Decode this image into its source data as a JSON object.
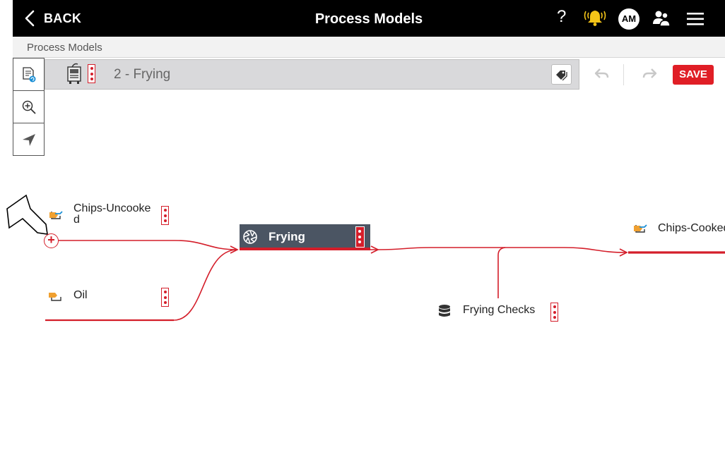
{
  "header": {
    "back_label": "BACK",
    "title": "Process Models",
    "help_label": "?",
    "avatar_initials": "AM",
    "icons": [
      "back-chevron-icon",
      "help-icon",
      "alarm-bell-icon",
      "avatar",
      "users-icon",
      "hamburger-menu-icon"
    ],
    "alert_color": "#f5c518"
  },
  "breadcrumb": {
    "label": "Process Models"
  },
  "toolbar": {
    "tools": [
      "document-refresh-icon",
      "zoom-in-icon",
      "navigate-arrow-icon"
    ]
  },
  "model": {
    "name": "2 - Frying",
    "icon": "fryer-machine-icon",
    "tag_icon": "tag-icon"
  },
  "actions": {
    "save_label": "SAVE",
    "undo_icon": "undo-icon",
    "redo_icon": "redo-icon"
  },
  "canvas": {
    "inputs": [
      {
        "label_line1": "Chips-Uncooke",
        "label_line2": "d",
        "icon": "material-input-icon"
      },
      {
        "label": "Oil",
        "icon": "material-input-icon"
      }
    ],
    "process": {
      "label": "Frying",
      "icon": "aperture-process-icon"
    },
    "check": {
      "label": "Frying Checks",
      "icon": "database-icon"
    },
    "output": {
      "label": "Chips-Cooked",
      "icon": "material-output-icon"
    },
    "add_handle": "+",
    "accent_color": "#d41e2a",
    "process_color": "#4b5563"
  }
}
